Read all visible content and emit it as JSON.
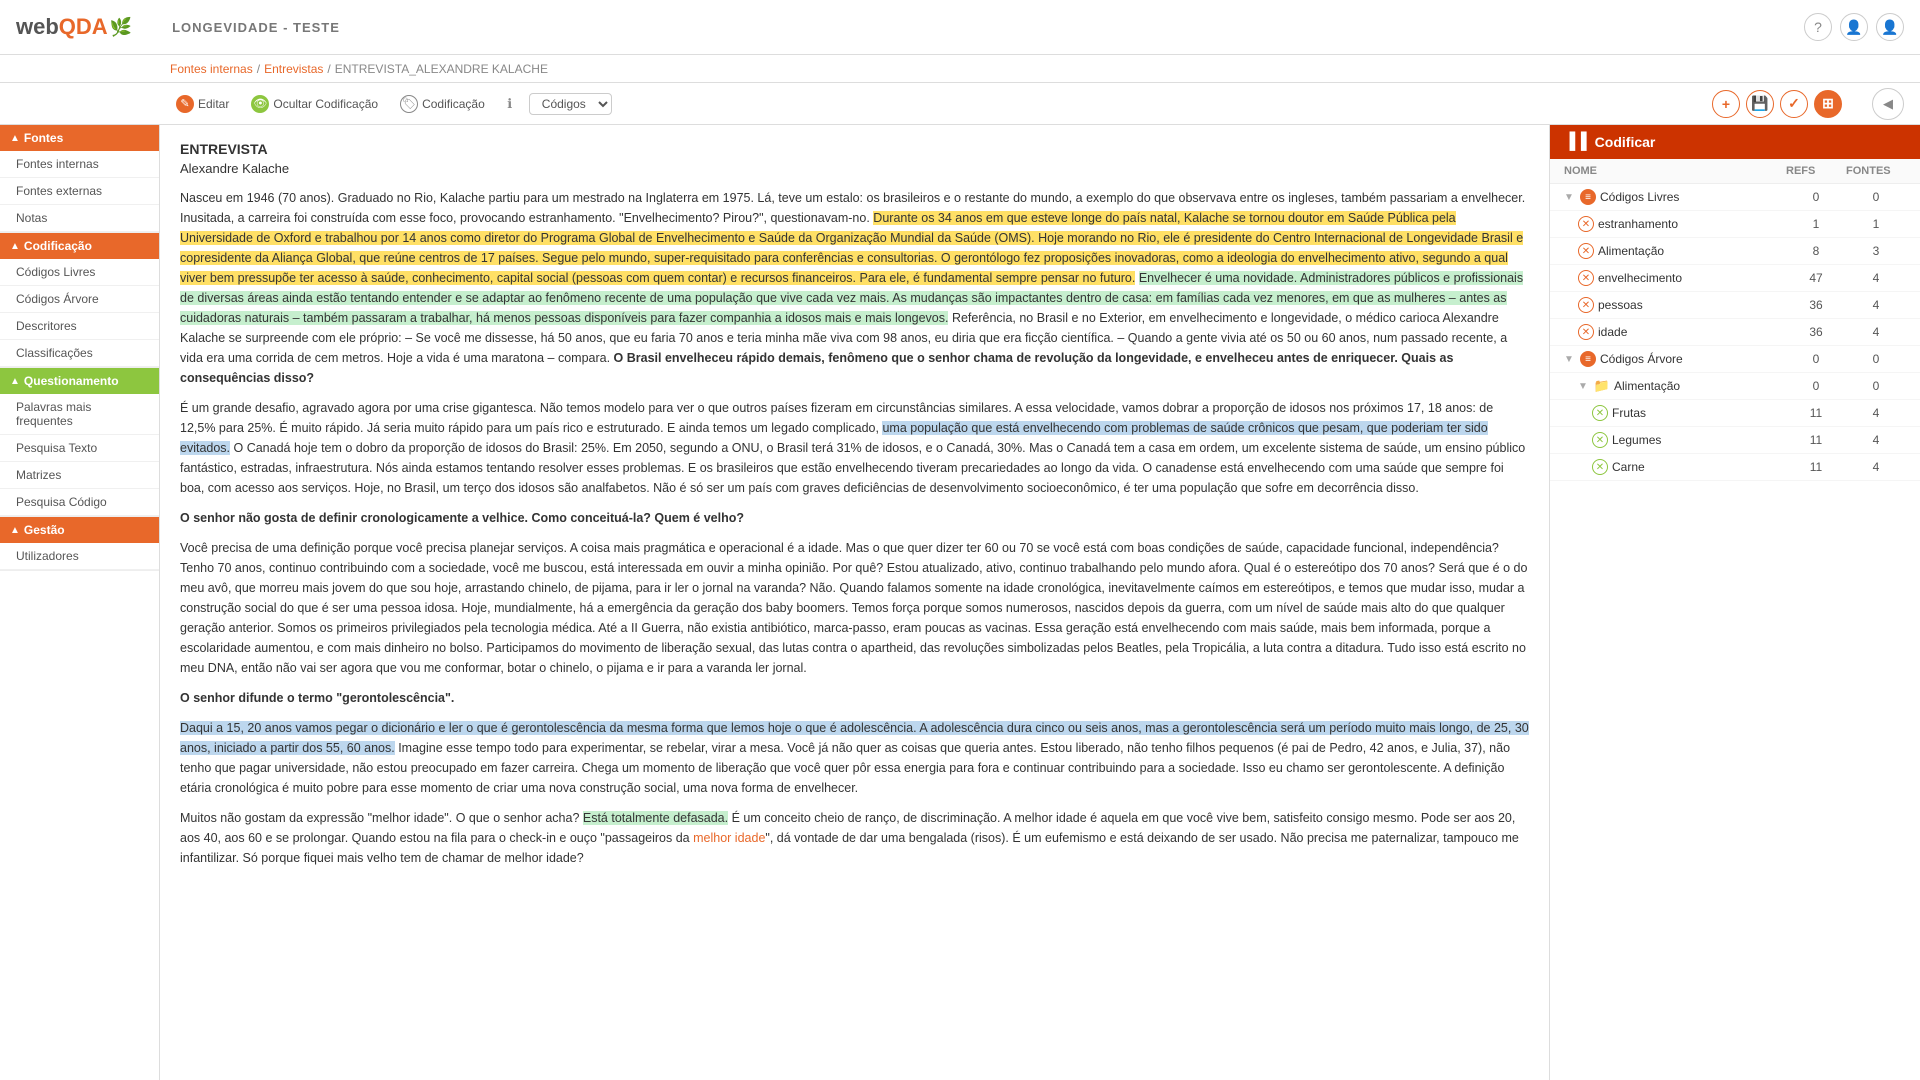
{
  "header": {
    "logo_web": "web",
    "logo_qda": "QDA",
    "title": "LONGEVIDADE - TESTE",
    "icon_help": "?",
    "icon_user": "👤",
    "icon_account": "👤"
  },
  "breadcrumb": {
    "part1": "Fontes internas",
    "sep1": "/",
    "part2": "Entrevistas",
    "sep2": "/",
    "part3": "ENTREVISTA_ALEXANDRE KALACHE"
  },
  "toolbar": {
    "edit_label": "Editar",
    "hide_coding_label": "Ocultar Codificação",
    "coding_label": "Codificação",
    "select_default": "Códigos",
    "btn_plus": "+",
    "btn_save": "💾",
    "btn_check": "✓",
    "btn_grid": "⊞"
  },
  "sidebar": {
    "section_fontes": "Fontes",
    "item_fontes_internas": "Fontes internas",
    "item_fontes_externas": "Fontes externas",
    "item_notas": "Notas",
    "section_codificacao": "Codificação",
    "item_codigos_livres": "Códigos Livres",
    "item_codigos_arvore": "Códigos Árvore",
    "item_descritores": "Descritores",
    "item_classificacoes": "Classificações",
    "section_questionamento": "Questionamento",
    "item_palavras": "Palavras mais frequentes",
    "item_pesquisa_texto": "Pesquisa Texto",
    "item_matrizes": "Matrizes",
    "item_pesquisa_codigo": "Pesquisa Código",
    "section_gestao": "Gestão",
    "item_utilizadores": "Utilizadores"
  },
  "document": {
    "title": "ENTREVISTA",
    "author": "Alexandre Kalache",
    "paragraphs": [
      "Nasceu em 1946 (70 anos). Graduado no Rio, Kalache partiu para um mestrado na Inglaterra em 1975. Lá, teve um estalo: os brasileiros e o restante do mundo, a exemplo do que observava entre os ingleses, também passariam a envelhecer. Inusitada, a carreira foi construída com esse foco, provocando estranhamento. \"Envelhecimento? Pirou?\", questionavam-no. Durante os 34 anos em que esteve longe do país natal, Kalache se tornou doutor em Saúde Pública pela Universidade de Oxford e trabalhou por 14 anos como diretor do Programa Global de Envelhecimento e Saúde da Organização Mundial da Saúde (OMS). Hoje morando no Rio, ele é presidente do Centro Internacional de Longevidade Brasil e copresidente da Aliança Global, que reúne centros de 17 países. Segue pelo mundo, super-requisitado para conferências e consultorias. O gerontólogo fez proposições inovadoras, como a ideologia do envelhecimento ativo, segundo a qual viver bem pressupõe ter acesso à saúde, conhecimento, capital social (pessoas com quem contar) e recursos financeiros. Para ele, é fundamental sempre pensar no futuro. Envelhecer é uma novidade. Administradores públicos e profissionais de diversas áreas ainda estão tentando entender e se adaptar ao fenômeno recente de uma população que vive cada vez mais. As mudanças são impactantes dentro de casa: em famílias cada vez menores, em que as mulheres – antes as cuidadoras naturais – também passaram a trabalhar, há menos pessoas disponíveis para fazer companhia a idosos mais e mais longevos. Referência, no Brasil e no Exterior, em envelhecimento e longevidade, o médico carioca Alexandre Kalache se surpreende com ele próprio: – Se você me dissesse, há 50 anos, que eu faria 70 anos e teria minha mãe viva com 98 anos, eu diria que era ficção científica. – Quando a gente vivia até os 50 ou 60 anos, num passado recente, a vida era uma corrida de cem metros. Hoje a vida é uma maratona – compara. O Brasil envelheceu rápido demais, fenômeno que o senhor chama de revolução da longevidade, e envelheceu antes de enriquecer. Quais as consequências disso?",
      "É um grande desafio, agravado agora por uma crise gigantesca. Não temos modelo para ver o que outros países fizeram em circunstâncias similares. A essa velocidade, vamos dobrar a proporção de idosos nos próximos 17, 18 anos: de 12,5% para 25%. É muito rápido. Já seria muito rápido para um país rico e estruturado. E ainda temos um legado complicado, uma população que está envelhecendo com problemas de saúde crônicos que pesam, que poderiam ter sido evitados. O Canadá hoje tem o dobro da proporção de idosos do Brasil: 25%. Em 2050, segundo a ONU, o Brasil terá 31% de idosos, e o Canadá, 30%. Mas o Canadá tem a casa em ordem, um excelente sistema de saúde, um ensino público fantástico, estradas, infraestrutura. Nós ainda estamos tentando resolver esses problemas. E os brasileiros que estão envelhecendo tiveram precariedades ao longo da vida. O canadense está envelhecendo com uma saúde que sempre foi boa, com acesso aos serviços. Hoje, no Brasil, um terço dos idosos são analfabetos. Não é só ser um país com graves deficiências de desenvolvimento socioeconômico, é ter uma população que sofre em decorrência disso.",
      "O senhor não gosta de definir cronologicamente a velhice. Como conceituá-la? Quem é velho?",
      "Você precisa de uma definição porque você precisa planejar serviços. A coisa mais pragmática e operacional é a idade. Mas o que quer dizer ter 60 ou 70 se você está com boas condições de saúde, capacidade funcional, independência? Tenho 70 anos, continuo contribuindo com a sociedade, você me buscou, está interessada em ouvir a minha opinião. Por quê? Estou atualizado, ativo, continuo trabalhando pelo mundo afora. Qual é o estereótipo dos 70 anos? Será que é o do meu avô, que morreu mais jovem do que sou hoje, arrastando chinelo, de pijama, para ir ler o jornal na varanda? Não. Quando falamos somente na idade cronológica, inevitavelmente caímos em estereótipos, e temos que mudar isso, mudar a construção social do que é ser uma pessoa idosa. Hoje, mundialmente, há a emergência da geração dos baby boomers. Temos força porque somos numerosos, nascidos depois da guerra, com um nível de saúde mais alto do que qualquer geração anterior. Somos os primeiros privilegiados pela tecnologia médica. Até a II Guerra, não existia antibiótico, marca-passo, eram poucas as vacinas. Essa geração está envelhecendo com mais saúde, mais bem informada, porque a escolaridade aumentou, e com mais dinheiro no bolso. Participamos do movimento de liberação sexual, das lutas contra o apartheid, das revoluções simbolizadas pelos Beatles, pela Tropicália, a luta contra a ditadura. Tudo isso está escrito no meu DNA, então não vai ser agora que vou me conformar, botar o chinelo, o pijama e ir para a varanda ler jornal.",
      "O senhor difunde o termo \"gerontolescência\".",
      "Daqui a 15, 20 anos vamos pegar o dicionário e ler o que é gerontolescência da mesma forma que lemos hoje o que é adolescência. A adolescência dura cinco ou seis anos, mas a gerontolescência será um período muito mais longo, de 25, 30 anos, iniciado a partir dos 55, 60 anos. Imagine esse tempo todo para experimentar, se rebelar, virar a mesa. Você já não quer as coisas que queria antes. Estou liberado, não tenho filhos pequenos (é pai de Pedro, 42 anos, e Julia, 37), não tenho que pagar universidade, não estou preocupado em fazer carreira. Chega um momento de liberação que você quer pôr essa energia para fora e continuar contribuindo para a sociedade. Isso eu chamo ser gerontolescente. A definição etária cronológica é muito pobre para esse momento de criar uma nova construção social, uma nova forma de envelhecer.",
      "Muitos não gostam da expressão \"melhor idade\". O que o senhor acha? Está totalmente defasada. É um conceito cheio de ranço, de discriminação. A melhor idade é aquela em que você vive bem, satisfeito consigo mesmo. Pode ser aos 20, aos 40, aos 60 e se prolongar. Quando estou na fila para o check-in e ouço \"passageiros da melhor idade\", dá vontade de dar uma bengalada (risos). É um eufemismo e está deixando de ser usado. Não precisa me paternalizar, tampouco me infantilizar. Só porque fiquei mais velho tem de chamar de melhor idade?"
    ]
  },
  "codify": {
    "header_label": "Codificar",
    "col_name": "NOME",
    "col_refs": "REFS",
    "col_fontes": "FONTES",
    "sections": [
      {
        "type": "group",
        "label": "Códigos Livres",
        "indent": 0,
        "refs": "0",
        "fontes": "0",
        "children": [
          {
            "label": "estranhamento",
            "indent": 1,
            "refs": "1",
            "fontes": "1",
            "icon": "x"
          },
          {
            "label": "Alimentação",
            "indent": 1,
            "refs": "8",
            "fontes": "3",
            "icon": "x"
          },
          {
            "label": "envelhecimento",
            "indent": 1,
            "refs": "47",
            "fontes": "4",
            "icon": "x"
          },
          {
            "label": "pessoas",
            "indent": 1,
            "refs": "36",
            "fontes": "4",
            "icon": "x"
          },
          {
            "label": "idade",
            "indent": 1,
            "refs": "36",
            "fontes": "4",
            "icon": "x"
          }
        ]
      },
      {
        "type": "group",
        "label": "Códigos Árvore",
        "indent": 0,
        "refs": "0",
        "fontes": "0",
        "children": [
          {
            "label": "Alimentação",
            "indent": 1,
            "refs": "0",
            "fontes": "0",
            "icon": "folder",
            "children": [
              {
                "label": "Frutas",
                "indent": 2,
                "refs": "11",
                "fontes": "4",
                "icon": "leaf"
              },
              {
                "label": "Legumes",
                "indent": 2,
                "refs": "11",
                "fontes": "4",
                "icon": "leaf"
              },
              {
                "label": "Carne",
                "indent": 2,
                "refs": "11",
                "fontes": "4",
                "icon": "leaf"
              }
            ]
          }
        ]
      }
    ]
  }
}
